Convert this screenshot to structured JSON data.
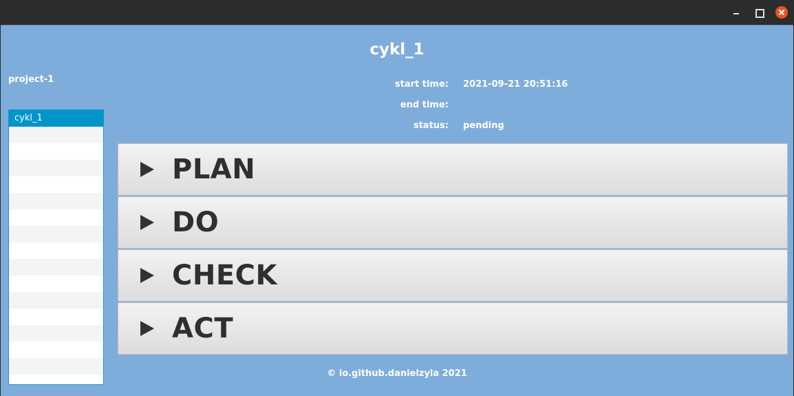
{
  "window": {
    "controls": [
      "minimize-icon",
      "maximize-icon",
      "close-icon"
    ],
    "close_color": "#e95420"
  },
  "header": {
    "cycle_title": "cykl_1"
  },
  "sidebar": {
    "project_label": "project-1",
    "items": [
      {
        "label": "cykl_1",
        "selected": true
      }
    ],
    "selected_color": "#0096c9"
  },
  "info": {
    "start_label": "start time:",
    "start_value": "2021-09-21 20:51:16",
    "end_label": "end time:",
    "end_value": "",
    "status_label": "status:",
    "status_value": "pending"
  },
  "panes": [
    {
      "label": "PLAN",
      "icon": "expand-arrow-icon"
    },
    {
      "label": "DO",
      "icon": "expand-arrow-icon"
    },
    {
      "label": "CHECK",
      "icon": "expand-arrow-icon"
    },
    {
      "label": "ACT",
      "icon": "expand-arrow-icon"
    }
  ],
  "footer": {
    "text": "© io.github.danielzyla 2021"
  },
  "colors": {
    "background": "#7eaddb",
    "text": "#ffffff"
  }
}
